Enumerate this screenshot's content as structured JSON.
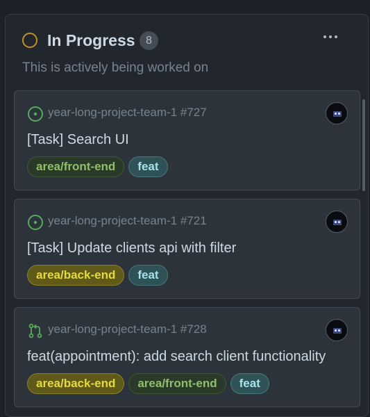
{
  "column": {
    "title": "In Progress",
    "count": "8",
    "description": "This is actively being worked on",
    "status_color": "#c69026"
  },
  "cards": [
    {
      "type_icon": "issue-open-icon",
      "ref": "year-long-project-team-1 #727",
      "title": "[Task] Search UI",
      "labels": [
        {
          "text": "area/front-end",
          "kind": "front"
        },
        {
          "text": "feat",
          "kind": "feat"
        }
      ]
    },
    {
      "type_icon": "issue-open-icon",
      "ref": "year-long-project-team-1 #721",
      "title": "[Task] Update clients api with filter",
      "labels": [
        {
          "text": "area/back-end",
          "kind": "back"
        },
        {
          "text": "feat",
          "kind": "feat"
        }
      ]
    },
    {
      "type_icon": "pull-request-icon",
      "ref": "year-long-project-team-1 #728",
      "title": "feat(appointment): add search client functionality",
      "labels": [
        {
          "text": "area/back-end",
          "kind": "back"
        },
        {
          "text": "area/front-end",
          "kind": "front"
        },
        {
          "text": "feat",
          "kind": "feat"
        }
      ]
    }
  ]
}
